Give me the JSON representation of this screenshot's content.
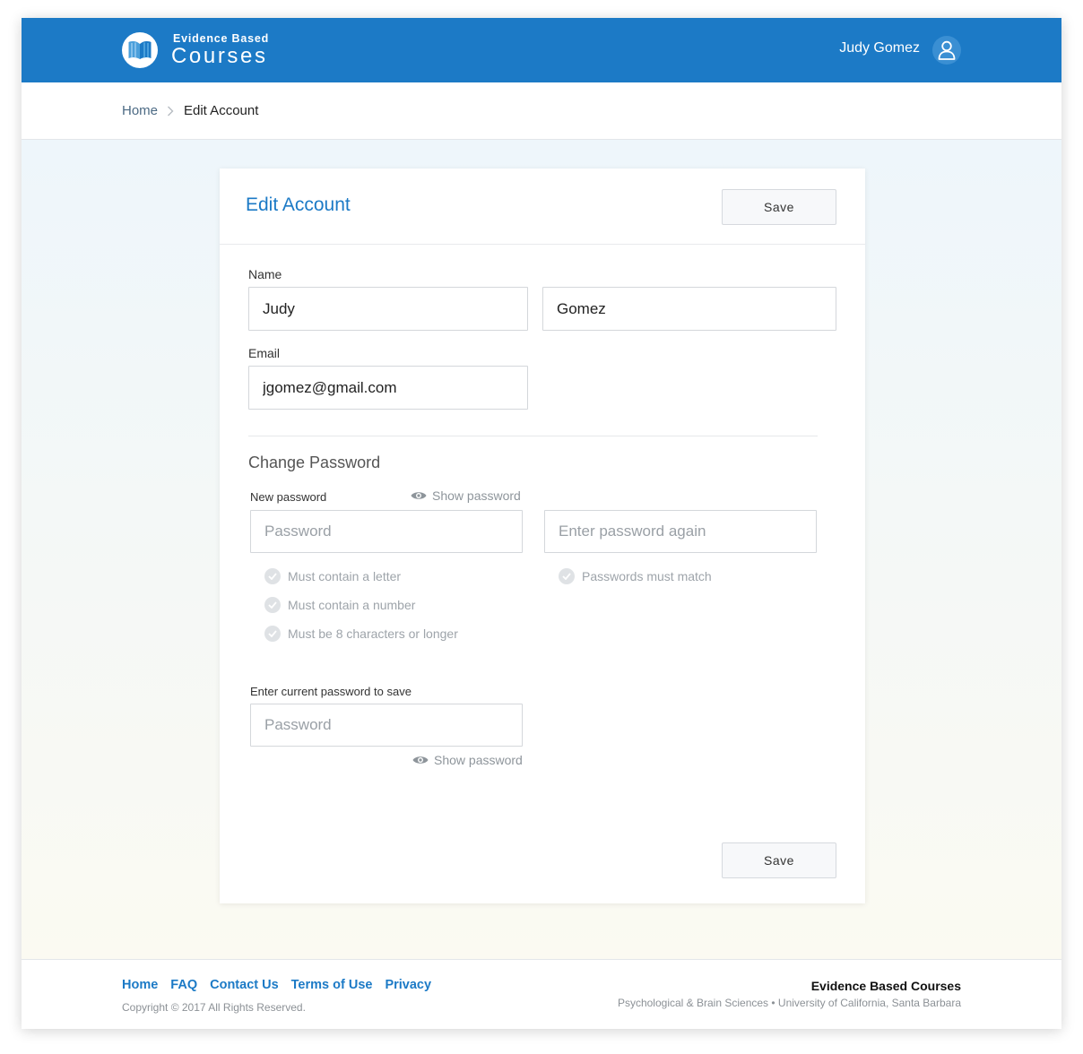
{
  "header": {
    "brand_small": "Evidence Based",
    "brand_big": "Courses",
    "logo_icon": "open-book-icon",
    "user_name": "Judy Gomez",
    "avatar_icon": "user-icon",
    "bar_color": "#1c7ac6"
  },
  "breadcrumb": {
    "home": "Home",
    "separator_icon": "chevron-right-icon",
    "current": "Edit Account"
  },
  "card": {
    "title": "Edit Account",
    "save_label": "Save",
    "name": {
      "label": "Name",
      "first_value": "Judy",
      "last_value": "Gomez"
    },
    "email": {
      "label": "Email",
      "value": "jgomez@gmail.com"
    },
    "change_password": {
      "title": "Change Password",
      "new_label": "New password",
      "show_password": "Show password",
      "new_placeholder": "Password",
      "confirm_placeholder": "Enter password again",
      "rules": [
        "Must contain a letter",
        "Must contain a number",
        "Must be 8 characters or longer"
      ],
      "match_rule": "Passwords must match"
    },
    "current_password": {
      "label": "Enter current password to save",
      "placeholder": "Password",
      "show_password": "Show password"
    }
  },
  "footer": {
    "links": [
      "Home",
      "FAQ",
      "Contact Us",
      "Terms of Use",
      "Privacy"
    ],
    "copyright": "Copyright © 2017 All Rights Reserved.",
    "brand": "Evidence Based Courses",
    "subtitle": "Psychological & Brain Sciences • University of California, Santa Barbara"
  }
}
